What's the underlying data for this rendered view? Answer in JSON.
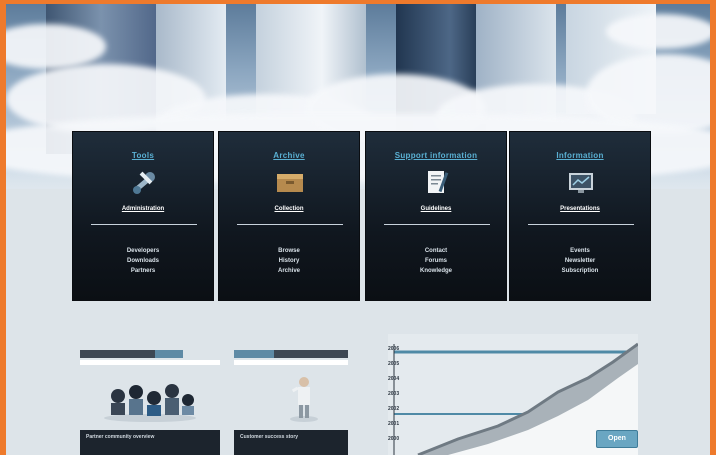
{
  "colors": {
    "frame": "#ee7a2c",
    "card_bg": "#10171f",
    "card_title": "#5ab0d3",
    "page_bg": "#dde4e9",
    "accent_blue": "#6aa6c2"
  },
  "cards": [
    {
      "title": "Tools",
      "icon": "wrench-tools-icon",
      "link": "Administration",
      "lines": [
        "Developers",
        "Downloads",
        "Partners"
      ]
    },
    {
      "title": "Archive",
      "icon": "archive-box-icon",
      "link": "Collection",
      "lines": [
        "Browse",
        "History",
        "Archive"
      ]
    },
    {
      "title": "Support information",
      "icon": "document-pen-icon",
      "link": "Guidelines",
      "lines": [
        "Contact",
        "Forums",
        "Knowledge"
      ]
    },
    {
      "title": "Information",
      "icon": "monitor-screen-icon",
      "link": "Presentations",
      "lines": [
        "Events",
        "Newsletter",
        "Subscription"
      ]
    }
  ],
  "promos": [
    {
      "image": "people-group-image",
      "caption": "Partner community overview"
    },
    {
      "image": "person-presenting-image",
      "caption": "Customer success story"
    }
  ],
  "graph": {
    "labels": [
      "2006",
      "2005",
      "2004",
      "2003",
      "2002",
      "2001",
      "2000"
    ],
    "button_label": "Open"
  }
}
